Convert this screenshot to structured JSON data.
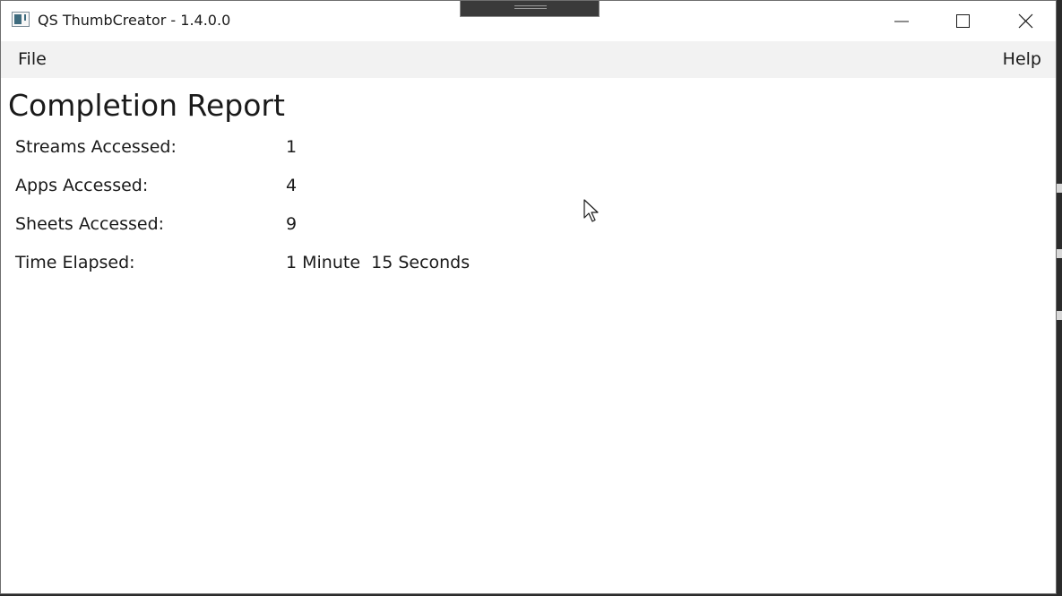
{
  "window": {
    "title": "QS ThumbCreator - 1.4.0.0",
    "icon": "app-window-icon"
  },
  "titlebar": {
    "minimize_icon": "minimize-icon",
    "maximize_icon": "maximize-icon",
    "close_icon": "close-icon"
  },
  "menu": {
    "file_label": "File",
    "help_label": "Help"
  },
  "report": {
    "title": "Completion Report",
    "rows": [
      {
        "label": "Streams Accessed:",
        "value": "1"
      },
      {
        "label": "Apps Accessed:",
        "value": "4"
      },
      {
        "label": "Sheets Accessed:",
        "value": "9"
      },
      {
        "label": "Time Elapsed:",
        "value": "1 Minute  15 Seconds"
      }
    ]
  },
  "colors": {
    "menubar_bg": "#f2f2f2",
    "window_bg": "#ffffff",
    "text": "#1a1a1a",
    "icon_accent": "#3e6b7e"
  }
}
